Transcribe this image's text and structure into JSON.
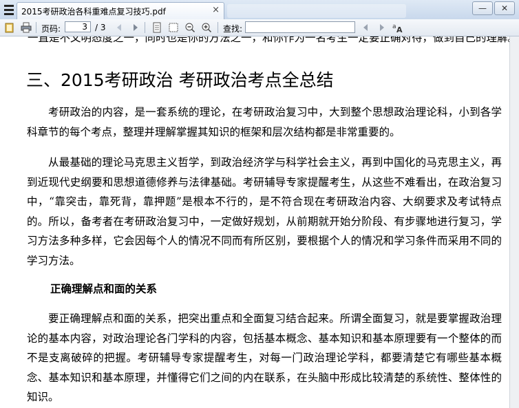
{
  "window": {
    "tab_title": "2015考研政治各科重难点复习技巧.pdf",
    "tab_close": "×",
    "minimize": "—",
    "close": "✕"
  },
  "toolbar": {
    "page_label": "页码:",
    "current_page": "3",
    "page_total": "/ 3",
    "find_label": "查找:",
    "find_value": "",
    "icons": [
      "open-file-icon",
      "print-icon",
      "prev-page-icon",
      "next-page-icon",
      "fit-page-icon",
      "fit-width-icon",
      "zoom-out-icon",
      "zoom-in-icon",
      "find-prev-icon",
      "find-next-icon",
      "match-case-icon"
    ]
  },
  "document": {
    "cut_line": "一直是不文明态度之一，同时也是你的方法之一，和你作为一名考生一定要正确对待，做到自己的理解。",
    "heading": "三、2015考研政治  考研政治考点全总结",
    "paragraphs": [
      "考研政治的内容，是一套系统的理论，在考研政治复习中，大到整个思想政治理论科，小到各学科章节的每个考点，整理并理解掌握其知识的框架和层次结构都是非常重要的。",
      "从最基础的理论马克思主义哲学，到政治经济学与科学社会主义，再到中国化的马克思主义，再到近现代史纲要和思想道德修养与法律基础。考研辅导专家提醒考生，从这些不难看出，在政治复习中，“靠突击，靠死背，靠押题”是根本不行的，是不符合现在考研政治内容、大纲要求及考试特点的。所以，备考者在考研政治复习中，一定做好规划，从前期就开始分阶段、有步骤地进行复习，学习方法多种多样，它会因每个人的情况不同而有所区别，要根据个人的情况和学习条件而采用不同的学习方法。"
    ],
    "subheading": "正确理解点和面的关系",
    "paragraph3": "要正确理解点和面的关系，把突出重点和全面复习结合起来。所谓全面复习，就是要掌握政治理论的基本内容，对政治理论各门学科的内容，包括基本概念、基本知识和基本原理要有一个整体的而不是支离破碎的把握。考研辅导专家提醒考生，对每一门政治理论学科，都要清楚它有哪些基本概念、基本知识和基本原理，并懂得它们之间的内在联系，在头脑中形成比较清楚的系统性、整体性的知识。"
  }
}
